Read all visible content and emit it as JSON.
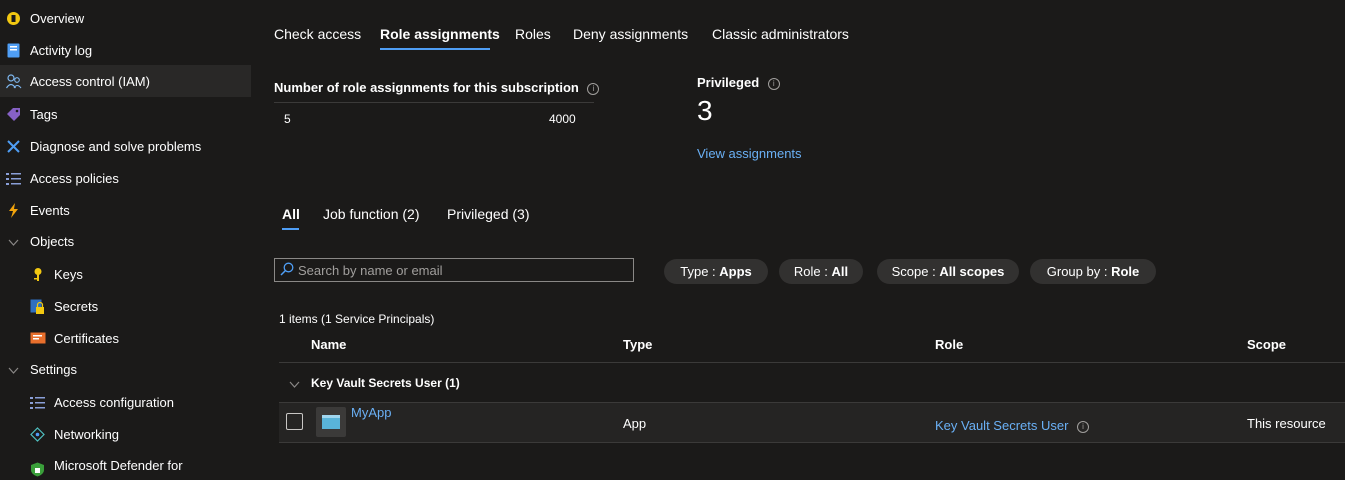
{
  "sidebar": {
    "items": [
      {
        "label": "Overview",
        "icon": "overview-icon"
      },
      {
        "label": "Activity log",
        "icon": "activity-log-icon"
      },
      {
        "label": "Access control (IAM)",
        "icon": "iam-icon",
        "active": true
      },
      {
        "label": "Tags",
        "icon": "tag-icon"
      },
      {
        "label": "Diagnose and solve problems",
        "icon": "wrench-icon"
      },
      {
        "label": "Access policies",
        "icon": "list-icon"
      },
      {
        "label": "Events",
        "icon": "lightning-icon"
      },
      {
        "label": "Objects",
        "icon": "chevron-down-icon"
      },
      {
        "label": "Keys",
        "icon": "key-icon"
      },
      {
        "label": "Secrets",
        "icon": "secret-icon"
      },
      {
        "label": "Certificates",
        "icon": "certificate-icon"
      },
      {
        "label": "Settings",
        "icon": "chevron-down-icon"
      },
      {
        "label": "Access configuration",
        "icon": "list-icon"
      },
      {
        "label": "Networking",
        "icon": "networking-icon"
      },
      {
        "label": "Microsoft Defender for",
        "icon": "shield-icon"
      }
    ]
  },
  "tabs": [
    "Check access",
    "Role assignments",
    "Roles",
    "Deny assignments",
    "Classic administrators"
  ],
  "summary": {
    "count_title": "Number of role assignments for this subscription",
    "count_current": "5",
    "count_max": "4000",
    "privileged_title": "Privileged",
    "privileged_value": "3",
    "view_link": "View assignments"
  },
  "subtabs": [
    "All",
    "Job function (2)",
    "Privileged (3)"
  ],
  "search": {
    "placeholder": "Search by name or email"
  },
  "filters": [
    {
      "key": "Type : ",
      "value": "Apps"
    },
    {
      "key": "Role : ",
      "value": "All"
    },
    {
      "key": "Scope : ",
      "value": "All scopes"
    },
    {
      "key": "Group by : ",
      "value": "Role"
    }
  ],
  "results": {
    "count_text": "1 items (1 Service Principals)",
    "columns": [
      "Name",
      "Type",
      "Role",
      "Scope"
    ],
    "group_label": "Key Vault Secrets User (1)",
    "rows": [
      {
        "name": "MyApp",
        "type": "App",
        "role": "Key Vault Secrets User",
        "scope": "This resource"
      }
    ]
  },
  "colors": {
    "accent": "#4f9ef5",
    "link": "#6ab0f5",
    "background": "#1b1a19"
  }
}
